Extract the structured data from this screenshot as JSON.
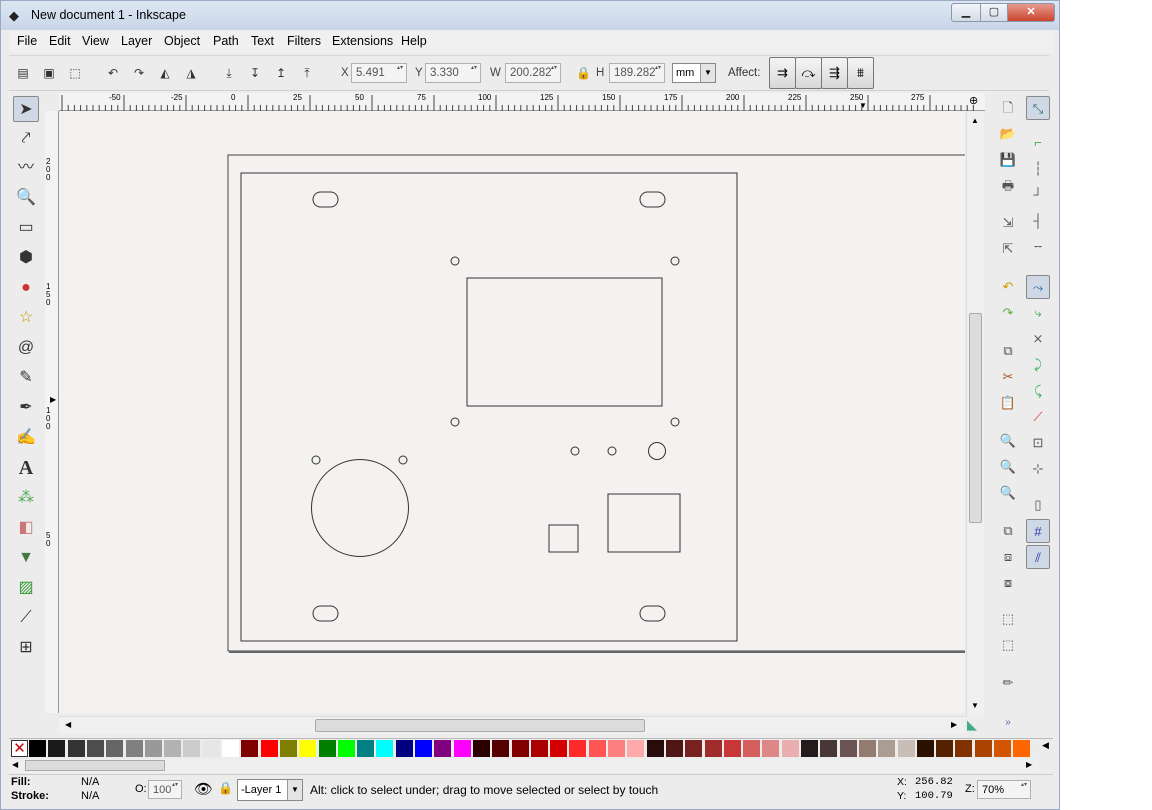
{
  "window": {
    "title": "New document 1 - Inkscape",
    "min": "▁",
    "max": "▢",
    "close": "✕"
  },
  "menu": [
    "File",
    "Edit",
    "View",
    "Layer",
    "Object",
    "Path",
    "Text",
    "Filters",
    "Extensions",
    "Help"
  ],
  "toolbar": {
    "x_label": "X",
    "x_value": "5.491",
    "y_label": "Y",
    "y_value": "3.330",
    "w_label": "W",
    "w_value": "200.282",
    "h_label": "H",
    "h_value": "189.282",
    "unit": "mm",
    "affect_label": "Affect:"
  },
  "rulers": {
    "h_ticks": [
      "-50",
      "-25",
      "0",
      "25",
      "50",
      "75",
      "100",
      "125",
      "150",
      "175",
      "200",
      "225",
      "250",
      "275"
    ],
    "v_ticks": [
      "200",
      "150",
      "100",
      "50"
    ]
  },
  "status": {
    "fill_label": "Fill:",
    "fill_value": "N/A",
    "stroke_label": "Stroke:",
    "stroke_value": "N/A",
    "opacity_label": "O:",
    "opacity_value": "100",
    "layer": "-Layer 1",
    "message": "Alt: click to select under; drag to move selected or select by touch",
    "x_label": "X:",
    "x_value": "256.82",
    "y_label": "Y:",
    "y_value": "100.79",
    "zoom_label": "Z:",
    "zoom_value": "70%"
  },
  "palette_colors": [
    "#000000",
    "#1a1a1a",
    "#333333",
    "#4d4d4d",
    "#666666",
    "#808080",
    "#999999",
    "#b3b3b3",
    "#cccccc",
    "#e6e6e6",
    "#ffffff",
    "#800000",
    "#ff0000",
    "#808000",
    "#ffff00",
    "#008000",
    "#00ff00",
    "#008080",
    "#00ffff",
    "#000080",
    "#0000ff",
    "#800080",
    "#ff00ff",
    "#2b0000",
    "#550000",
    "#800000",
    "#aa0000",
    "#d40000",
    "#ff2a2a",
    "#ff5555",
    "#ff8080",
    "#ffaaaa",
    "#280b0b",
    "#501616",
    "#782121",
    "#a02c2c",
    "#c83737",
    "#d35f5f",
    "#de8787",
    "#e9afaf",
    "#241c1c",
    "#483737",
    "#6c5353",
    "#917c6f",
    "#ac9d93",
    "#c8beb7",
    "#2b1100",
    "#552200",
    "#803300",
    "#aa4400",
    "#d45500",
    "#ff6600"
  ]
}
